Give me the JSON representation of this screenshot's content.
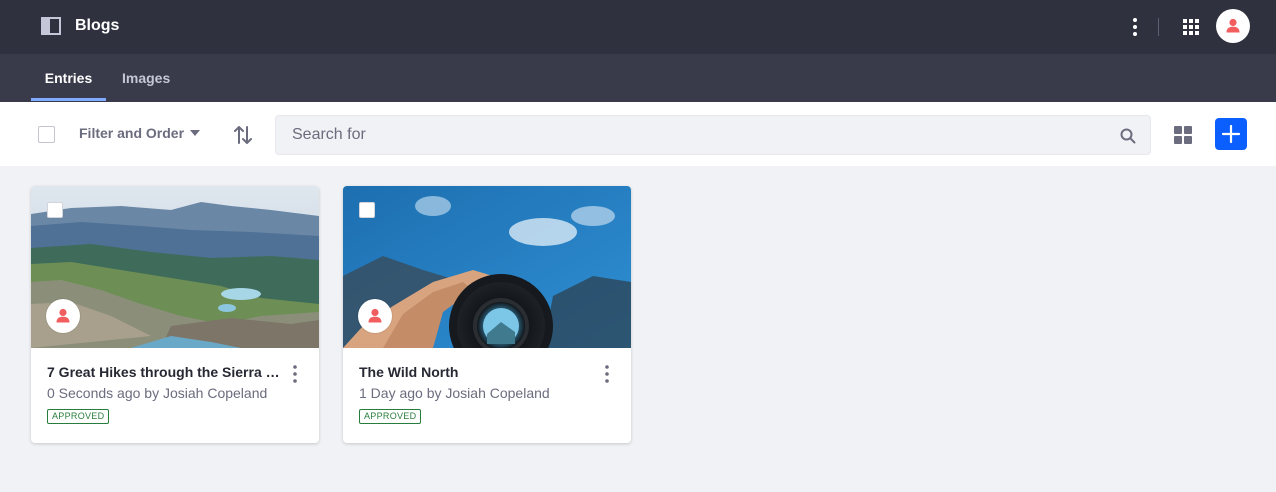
{
  "app": {
    "title": "Blogs",
    "icons": {
      "panel_toggle": "product-menu-icon",
      "options": "ellipsis-vertical-icon",
      "apps": "grid-apps-icon",
      "user": "user-avatar-icon"
    }
  },
  "nav": {
    "tabs": [
      {
        "label": "Entries",
        "active": true
      },
      {
        "label": "Images",
        "active": false
      }
    ]
  },
  "toolbar": {
    "filter_label": "Filter and Order",
    "search_placeholder": "Search for",
    "search_value": ""
  },
  "entries": [
    {
      "title": "7 Great Hikes through the Sierra N...",
      "meta": "0 Seconds ago by Josiah Copeland",
      "status": "APPROVED"
    },
    {
      "title": "The Wild North",
      "meta": "1 Day ago by Josiah Copeland",
      "status": "APPROVED"
    }
  ],
  "colors": {
    "topbar": "#30313f",
    "navbar": "#393a4a",
    "active_tab_indicator": "#80acff",
    "primary": "#0b5fff",
    "avatar_accent": "#f25e5e",
    "approved": "#287d3c",
    "page_bg": "#f1f2f5"
  }
}
